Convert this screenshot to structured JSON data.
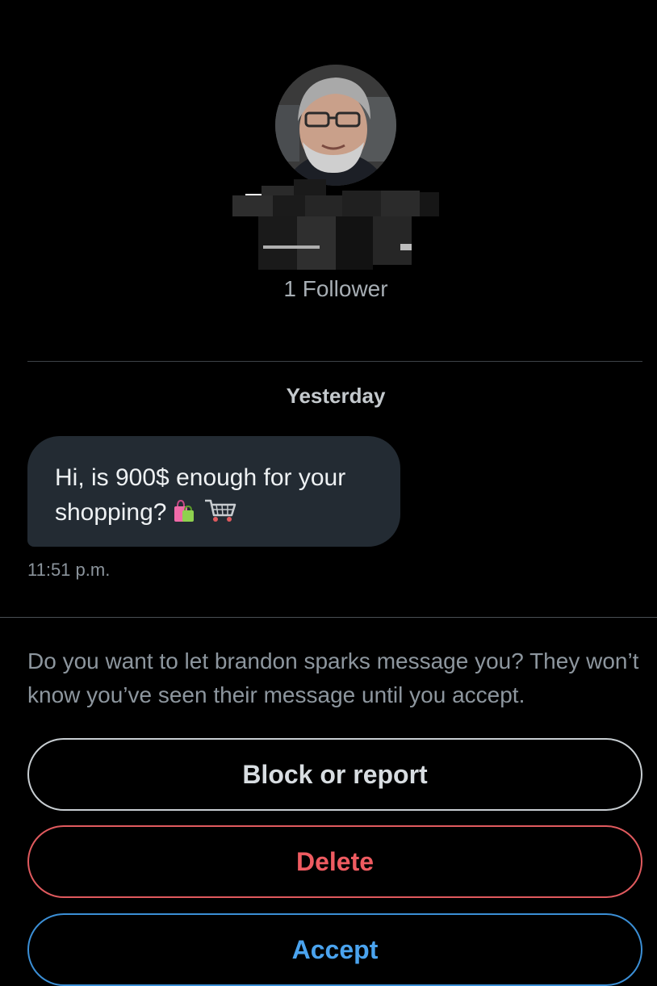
{
  "profile": {
    "followers_text": "1 Follower"
  },
  "conversation": {
    "date_separator": "Yesterday",
    "message": {
      "line1": "Hi, is 900$ enough for  your",
      "line2": "shopping?",
      "emoji_icons": [
        "shopping-bags-icon",
        "shopping-cart-icon"
      ],
      "timestamp": "11:51 p.m."
    }
  },
  "request": {
    "prompt": "Do you want to let brandon sparks message you? They won’t know you’ve seen their message until you accept."
  },
  "actions": {
    "block_label": "Block or report",
    "delete_label": "Delete",
    "accept_label": "Accept"
  },
  "colors": {
    "background": "#000000",
    "bubble": "#232b33",
    "delete": "#ef5b61",
    "accept": "#4aa3ee"
  }
}
